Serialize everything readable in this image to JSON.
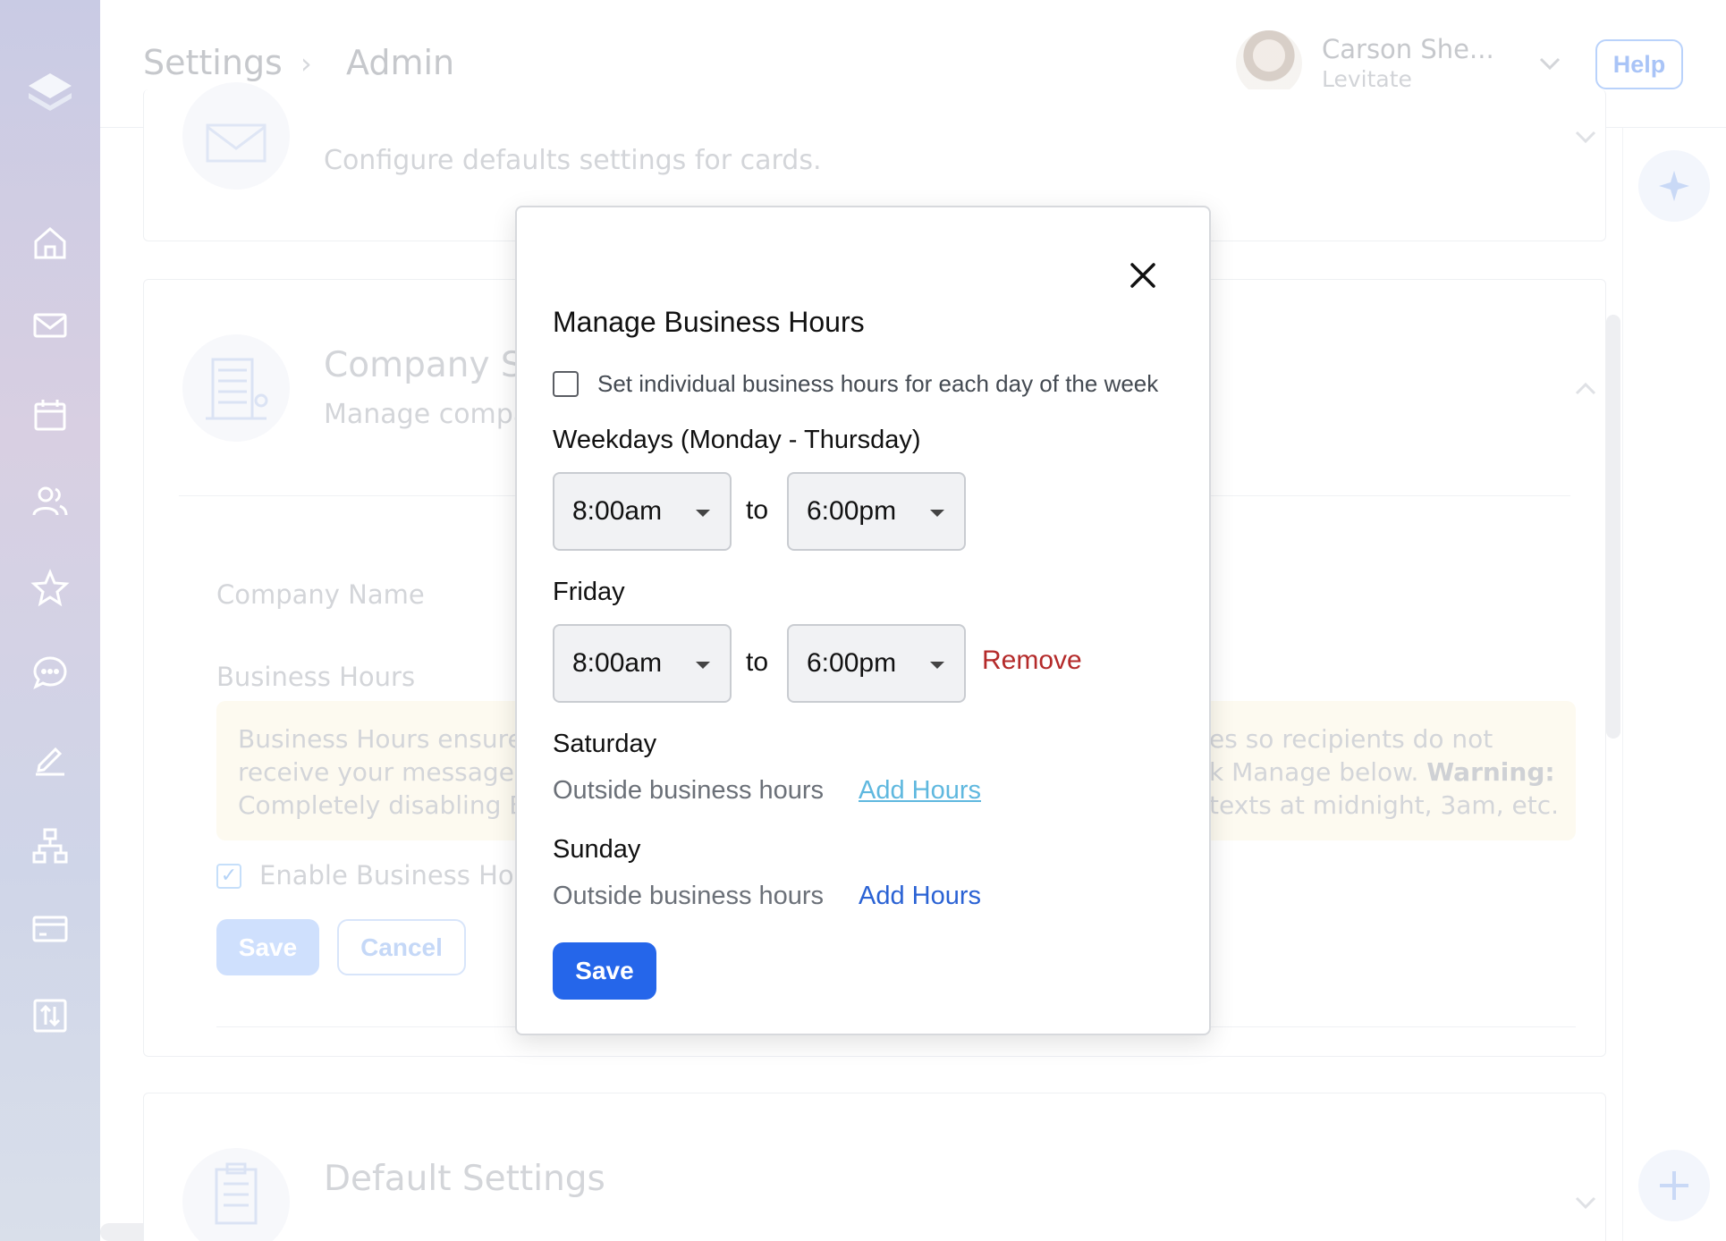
{
  "header": {
    "breadcrumb": [
      "Settings",
      "Admin"
    ],
    "breadcrumb_separator": "›",
    "user_name": "Carson She...",
    "user_org": "Levitate",
    "help_label": "Help"
  },
  "background": {
    "card_defaults_subtitle": "Configure defaults settings for cards.",
    "company_title": "Company Se",
    "company_subtitle": "Manage compa",
    "company_name_label": "Company Name",
    "business_hours_label": "Business Hours",
    "notice_left_lines": [
      "Business Hours ensure t",
      "receive your messages a",
      "Completely disabling Bu"
    ],
    "notice_right_line1": "es so recipients do not",
    "notice_right_line2_prefix": "k Manage below. ",
    "notice_right_line2_bold": "Warning:",
    "notice_right_line3": "texts at midnight, 3am, etc.",
    "enable_label": "Enable Business Hou",
    "save_label": "Save",
    "cancel_label": "Cancel",
    "default_settings_title": "Default Settings"
  },
  "modal": {
    "title": "Manage Business Hours",
    "individual_label": "Set individual business hours for each day of the week",
    "individual_checked": false,
    "weekdays": {
      "label": "Weekdays (Monday - Thursday)",
      "start": "8:00am",
      "end": "6:00pm"
    },
    "friday": {
      "label": "Friday",
      "start": "8:00am",
      "end": "6:00pm",
      "remove_label": "Remove"
    },
    "saturday": {
      "label": "Saturday",
      "status": "Outside business hours",
      "action": "Add Hours"
    },
    "sunday": {
      "label": "Sunday",
      "status": "Outside business hours",
      "action": "Add Hours"
    },
    "to_label": "to",
    "save_label": "Save"
  },
  "colors": {
    "primary": "#2566ea",
    "remove": "#b42a2a",
    "link_hover": "#5fb8df"
  },
  "icons": {
    "sidebar": [
      "home-icon",
      "mail-icon",
      "calendar-icon",
      "contacts-icon",
      "star-icon",
      "chat-icon",
      "edit-icon",
      "org-chart-icon",
      "card-icon",
      "import-export-icon"
    ]
  }
}
